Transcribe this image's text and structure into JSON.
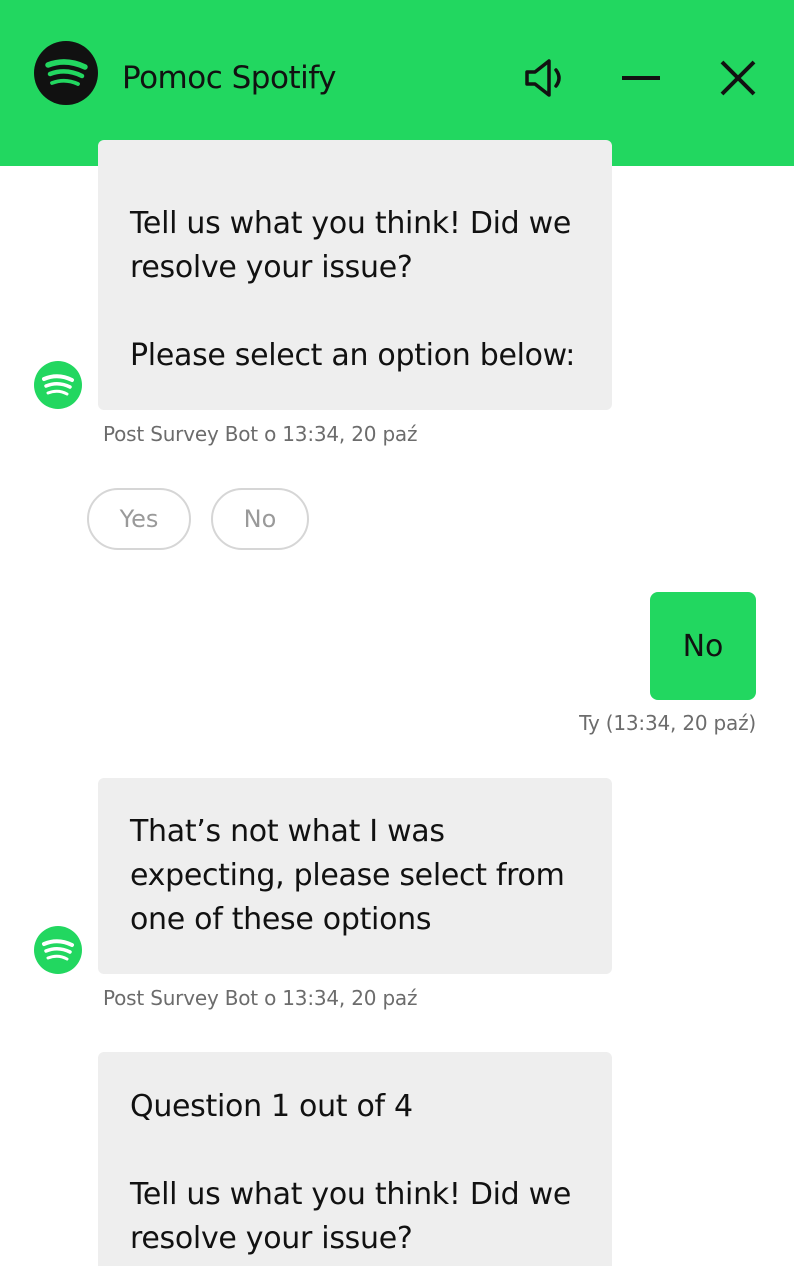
{
  "header": {
    "title": "Pomoc Spotify",
    "icons": {
      "logo": "spotify-logo-icon",
      "sound": "speaker-icon",
      "minimize": "minimize-icon",
      "close": "close-icon"
    }
  },
  "messages": [
    {
      "sender": "bot",
      "lines": [
        "Tell us what you think! Did we",
        "resolve your issue?",
        "",
        "Please select an option below:"
      ],
      "meta": "Post Survey Bot o 13:34, 20 paź"
    },
    {
      "sender": "user",
      "text": "No",
      "meta": "Ty (13:34, 20 paź)"
    },
    {
      "sender": "bot",
      "lines": [
        "That’s not what I was",
        "expecting, please select from",
        "one of these options"
      ],
      "meta": "Post Survey Bot o 13:34, 20 paź"
    },
    {
      "sender": "bot",
      "lines": [
        "Question 1 out of 4",
        "",
        "Tell us what you think! Did we",
        "resolve your issue?"
      ]
    }
  ],
  "quick_replies": [
    "Yes",
    "No"
  ],
  "colors": {
    "brand": "#22d760",
    "bubble_bg": "#eeeeee",
    "meta_text": "#6c6c6c"
  }
}
